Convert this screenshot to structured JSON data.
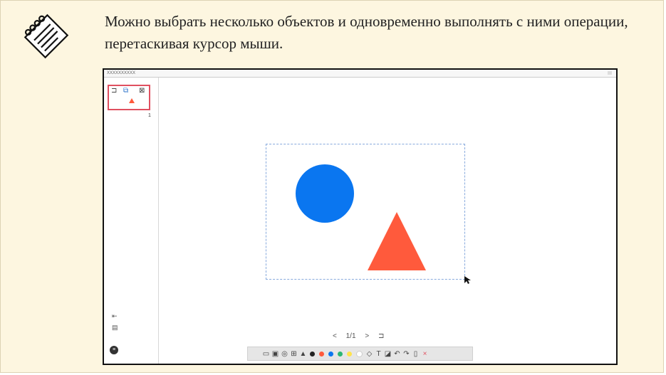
{
  "note": {
    "text": "Можно выбрать несколько объектов и одновременно выполнять с ними операции, перетаскивая курсор мыши."
  },
  "window": {
    "title": "XXXXXXXXXX"
  },
  "sidebar": {
    "page_number": "1"
  },
  "pager": {
    "prev": "<",
    "label": "1/1",
    "next": ">"
  },
  "toolbar": {
    "icons": [
      "monitor-icon",
      "save-icon",
      "camera-icon",
      "capture-icon",
      "pen-icon",
      "black-dot",
      "red-dot",
      "blue-dot",
      "green-dot",
      "yellow-dot",
      "white-dot",
      "eraser-icon",
      "text-icon",
      "select-icon",
      "undo-icon",
      "redo-icon",
      "delete-icon",
      "close-icon"
    ],
    "colors": {
      "black": "#222222",
      "red": "#ff5a3c",
      "blue": "#0a76f0",
      "green": "#2bb673",
      "yellow": "#ffe34d",
      "white": "#ffffff"
    },
    "text_tool": "T"
  },
  "colors": {
    "circle": "#0a76f0",
    "triangle": "#ff5a3c",
    "note_bg": "#fdf6e0"
  }
}
